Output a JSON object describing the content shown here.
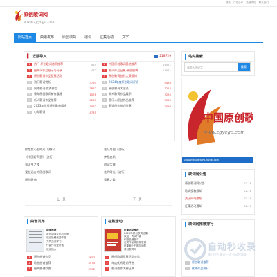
{
  "topbar": {
    "links": [
      "搜索",
      "广告合作",
      "投稿须知",
      "联系我们"
    ]
  },
  "header": {
    "site_title": "原创歌词网",
    "site_url": "www.zgycgc.com"
  },
  "nav": {
    "items": [
      "网站首页",
      "曲谱发布",
      "原创歌曲",
      "歌词",
      "征集活动",
      "文字"
    ]
  },
  "colors": {
    "accent": "#1e88e5",
    "red": "#c8252c",
    "hot": "#e64545"
  },
  "recommend": {
    "title": "近期导入",
    "count_label": "218729",
    "left_rows": [
      {
        "num": "1",
        "text": "热门·原创歌词首页推荐",
        "val": "455",
        "top": true
      },
      {
        "num": "2",
        "text": "经典词作品展示与分享",
        "val": "462",
        "top": true
      },
      {
        "num": "3",
        "text": "原创歌词作品征集活动",
        "val": "",
        "top": true
      },
      {
        "num": "4",
        "text": "流行歌词赏析",
        "val": "3794",
        "top": false
      },
      {
        "num": "5",
        "text": "网络歌词·优秀作品",
        "val": "3862",
        "top": false
      },
      {
        "num": "6",
        "text": "青年原创歌词新作展播",
        "val": "1578",
        "top": false
      },
      {
        "num": "7",
        "text": "新人歌词作品推荐",
        "val": "4283",
        "top": false
      },
      {
        "num": "8",
        "text": "2023年优秀原创歌曲展评",
        "val": "3062",
        "top": false
      },
      {
        "num": "9",
        "text": "心动歌词",
        "val": "4785",
        "top": false
      }
    ],
    "right_rows": [
      {
        "num": "1",
        "text": "中国原创歌词基地推荐",
        "val": "14571",
        "style": "red"
      },
      {
        "num": "2",
        "text": "歌词作品征集·原创投稿",
        "val": "14571",
        "style": "red"
      },
      {
        "num": "3",
        "text": "原创歌词创作大赛通知",
        "val": "",
        "style": "red"
      },
      {
        "num": "4",
        "text": "2024年度原创歌词评选",
        "val": "5438",
        "style": "blue"
      },
      {
        "num": "5",
        "text": "原创歌词大家谈",
        "val": "3218",
        "style": "dark"
      },
      {
        "num": "6",
        "text": "故乡歌词作品展示",
        "val": "3235",
        "style": "dark"
      },
      {
        "num": "7",
        "text": "音乐人原创作品推荐",
        "val": "3065",
        "style": "dark"
      },
      {
        "num": "8",
        "text": "歌词创作技巧分享",
        "val": "3098",
        "style": "dark"
      }
    ]
  },
  "plain_left": [
    "你是我心里的光（流行）",
    "《中国好声音》（流行）",
    "萤火虫之夜",
    "爱在远方的原创歌词",
    "原创歌曲"
  ],
  "plain_right": [
    "花好月圆（流行）",
    "梦想启航",
    "歌词大赛",
    "花的时光（流行）",
    "青春之歌"
  ],
  "pager": {
    "prev": "上一页",
    "next": "下一页"
  },
  "bottom_left": {
    "title": "曲谱发布",
    "feature_title": "曲谱推荐",
    "feature_lines": [
      "原创曲谱发布与分享",
      "欢迎投稿优秀作品",
      "共同交流学习",
      "作曲作词爱好者",
      "欢迎加入"
    ],
    "rows": [
      {
        "num": "1",
        "text": "原创曲谱作品",
        "val": "3657"
      },
      {
        "num": "2",
        "text": "歌曲曲谱推荐",
        "val": "3574"
      },
      {
        "num": "3",
        "text": "经典曲谱欣赏",
        "val": "3592"
      }
    ]
  },
  "bottom_mid": {
    "title": "征集活动",
    "feature_title": "征集活动推荐",
    "feature_lines": [
      "2024年原创歌词征集",
      "欢迎广大词作者",
      "积极投稿参与",
      "优秀作品将推荐发表",
      "征集截止日期见通知",
      "原创歌词网"
    ],
    "rows": [
      {
        "num": "1",
        "text": "原创歌词征集活动公告",
        "val": ""
      },
      {
        "num": "2",
        "text": "年度优秀歌词评选",
        "val": ""
      },
      {
        "num": "3",
        "text": "歌词创作大赛征稿",
        "val": ""
      }
    ]
  },
  "sidebar": {
    "search_title": "站内搜索",
    "search_placeholder": "请输入关键字",
    "search_button": "搜索",
    "banner_caption": "中国原创歌词网 www.zgycgc.com",
    "notice_title": "歌词网公告",
    "notice_rows": [
      {
        "text": "原创歌词网公告",
        "date": "02-18"
      },
      {
        "text": "歌词投稿须知",
        "date": "02-16"
      },
      {
        "text": "关于网站改版",
        "date": "02-19"
      },
      {
        "text": "征集活动通知",
        "date": "02-16"
      }
    ],
    "hot_title": "歌词网推荐排行",
    "hot_rows": [
      "原创歌词推荐",
      "优秀作品排行"
    ]
  },
  "watermark": {
    "title": "自动秒收录",
    "subtitle": "做上排名·来访·一次·自动秒收录"
  }
}
